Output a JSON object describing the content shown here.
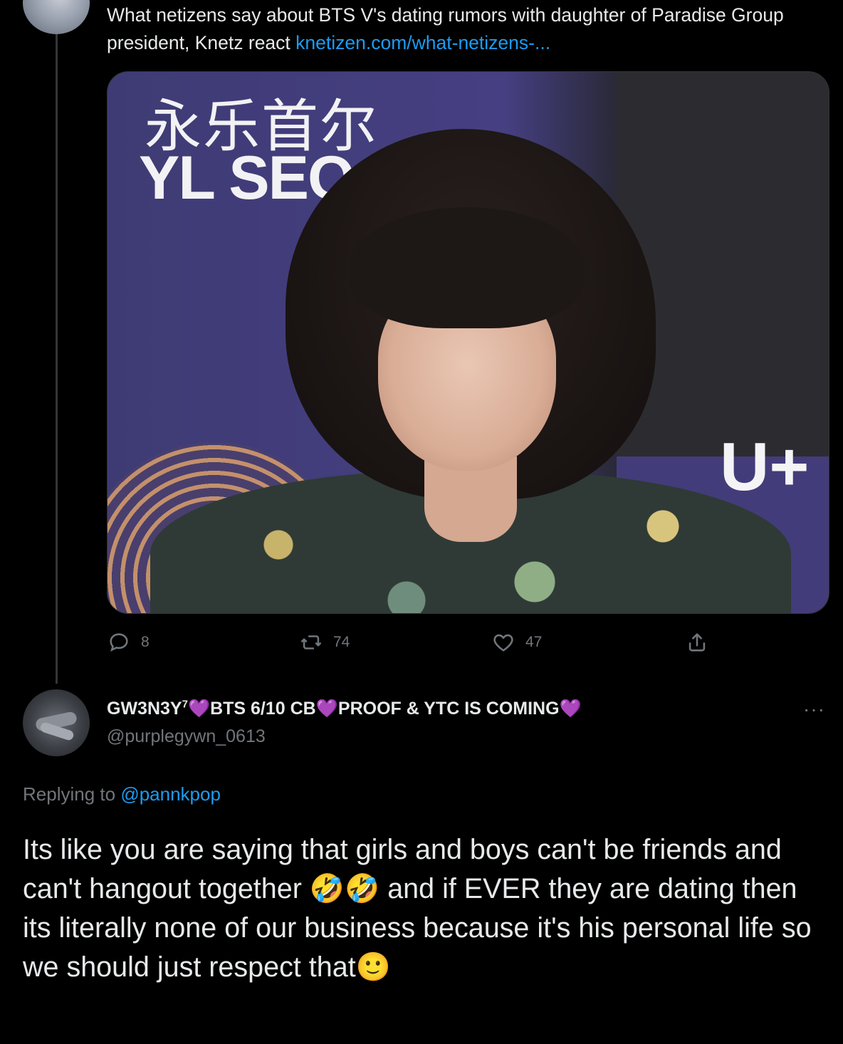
{
  "parent_tweet": {
    "text": "What netizens say about BTS V's dating rumors with daughter of Paradise Group president, Knetz react ",
    "link": "knetizen.com/what-netizens-...",
    "media": {
      "sign_chinese": "永乐首尔",
      "sign_english": "YL SEO",
      "sign_right": "U+"
    },
    "actions": {
      "reply_count": "8",
      "retweet_count": "74",
      "like_count": "47"
    }
  },
  "reply_tweet": {
    "display_name_parts": {
      "name": "GW3N3Y",
      "superscript": "7",
      "heart": "💜",
      "segment1": "BTS 6/10 CB",
      "segment2": "PROOF & YTC IS COMING"
    },
    "handle": "@purplegywn_0613",
    "more": "···",
    "replying_prefix": "Replying to ",
    "replying_to": "@pannkpop",
    "body_part1": "Its like you are saying that girls and boys can't be friends and can't hangout together ",
    "emoji_laugh": "🤣🤣",
    "body_part2": " and if EVER they are dating then its literally none of our business because it's his personal life so we should just respect that",
    "emoji_smile": "🙂"
  },
  "icons": {
    "reply": "reply-icon",
    "retweet": "retweet-icon",
    "like": "like-icon",
    "share": "share-icon"
  },
  "colors": {
    "background": "#000000",
    "text": "#e7e9ea",
    "muted": "#71767b",
    "link": "#1d9bf0",
    "heart": "#a78bfa"
  }
}
